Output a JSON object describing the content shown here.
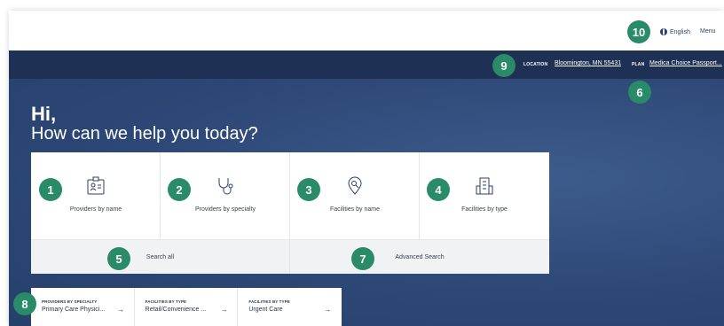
{
  "header": {
    "language_label": "English",
    "menu_label": "Menu"
  },
  "location_bar": {
    "location_label": "LOCATION",
    "location_value": "Bloomington, MN 55431",
    "plan_label": "PLAN",
    "plan_value": "Medica Choice Passport..."
  },
  "hero": {
    "greeting": "Hi,",
    "prompt": "How can we help you today?"
  },
  "search_cards": [
    {
      "label": "Providers by name",
      "icon": "id-badge-icon"
    },
    {
      "label": "Providers by specialty",
      "icon": "stethoscope-icon"
    },
    {
      "label": "Facilities by name",
      "icon": "location-search-icon"
    },
    {
      "label": "Facilities by type",
      "icon": "building-icon"
    }
  ],
  "search_links": {
    "search_all": "Search all",
    "advanced_search": "Advanced Search"
  },
  "shortcuts": [
    {
      "label": "PROVIDERS BY SPECIALTY",
      "value": "Primary Care Physici...",
      "arrow": "→"
    },
    {
      "label": "FACILITIES BY TYPE",
      "value": "Retail/Convenience ...",
      "arrow": "→"
    },
    {
      "label": "FACILITIES BY TYPE",
      "value": "Urgent Care",
      "arrow": "→"
    }
  ],
  "badges": [
    "1",
    "2",
    "3",
    "4",
    "5",
    "6",
    "7",
    "8",
    "9",
    "10"
  ],
  "colors": {
    "nav_dark": "#1e3155",
    "hero_blue": "#2d4876",
    "badge_green": "#2a8b68"
  }
}
